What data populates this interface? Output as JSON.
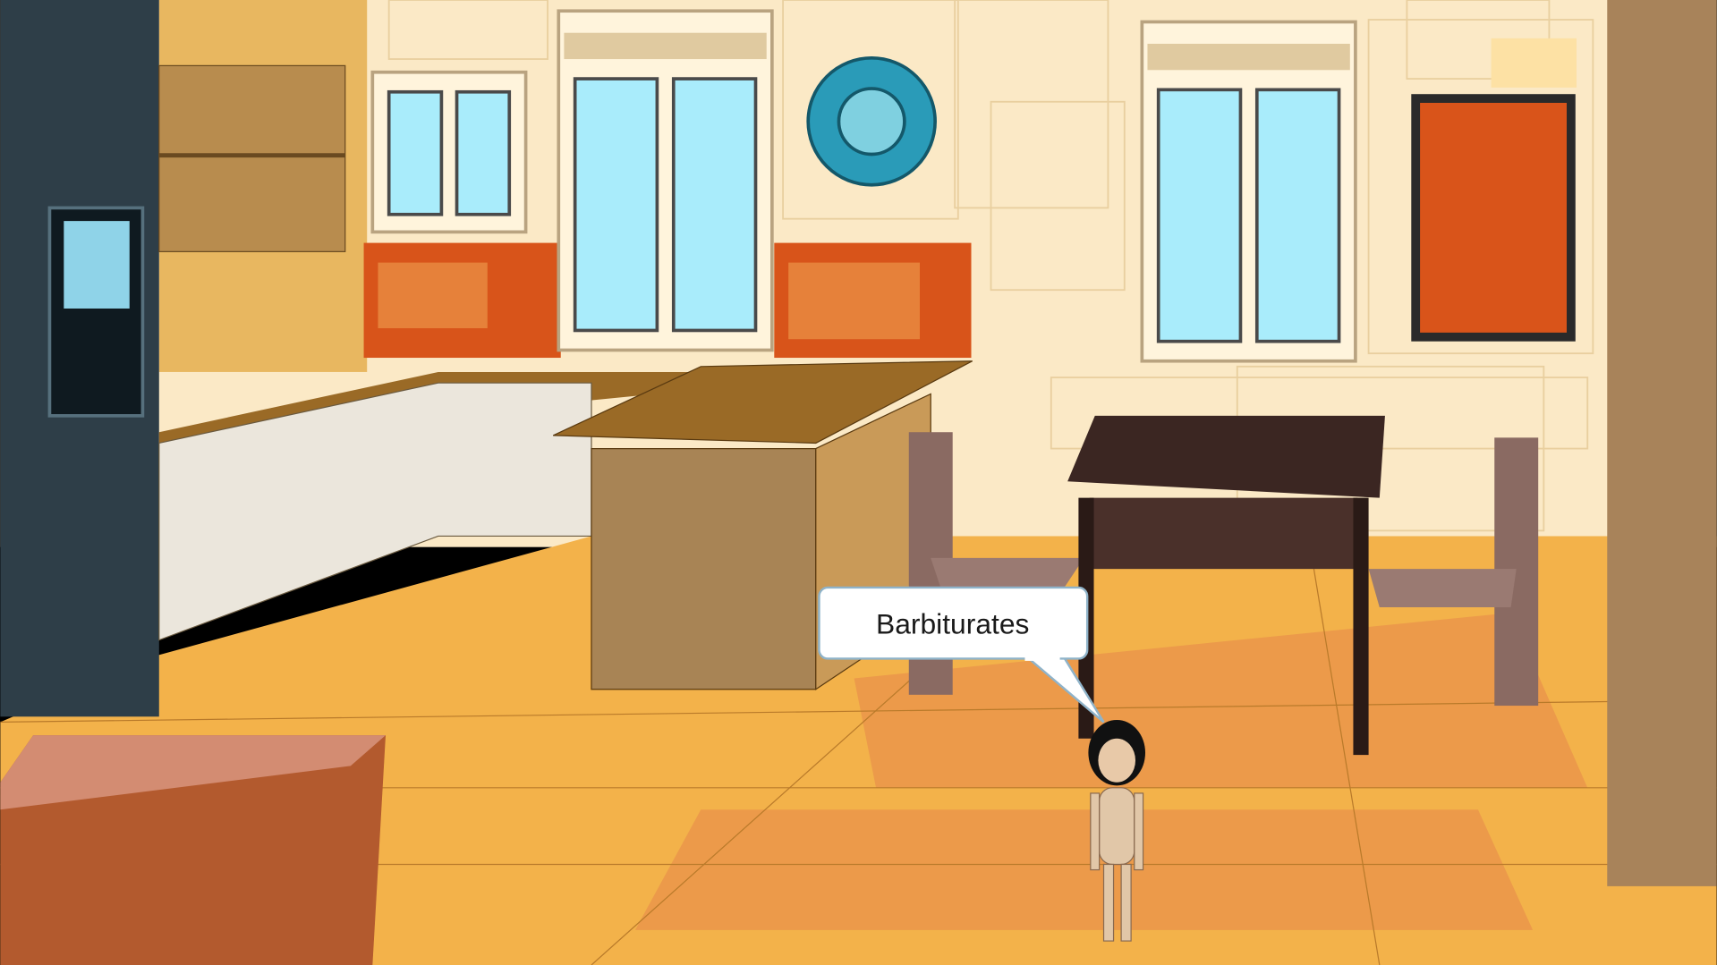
{
  "scene": {
    "speech_bubble": {
      "text": "Barbiturates"
    }
  },
  "colors": {
    "floor": "#f3b24a",
    "wall": "#fbe9c6",
    "backsplash": "#d8541a",
    "window_glass": "#a9ecfb",
    "fridge": "#2e3e48",
    "table": "#3b2622",
    "painting": "#d9541a",
    "plate": "#2a9bb8"
  }
}
